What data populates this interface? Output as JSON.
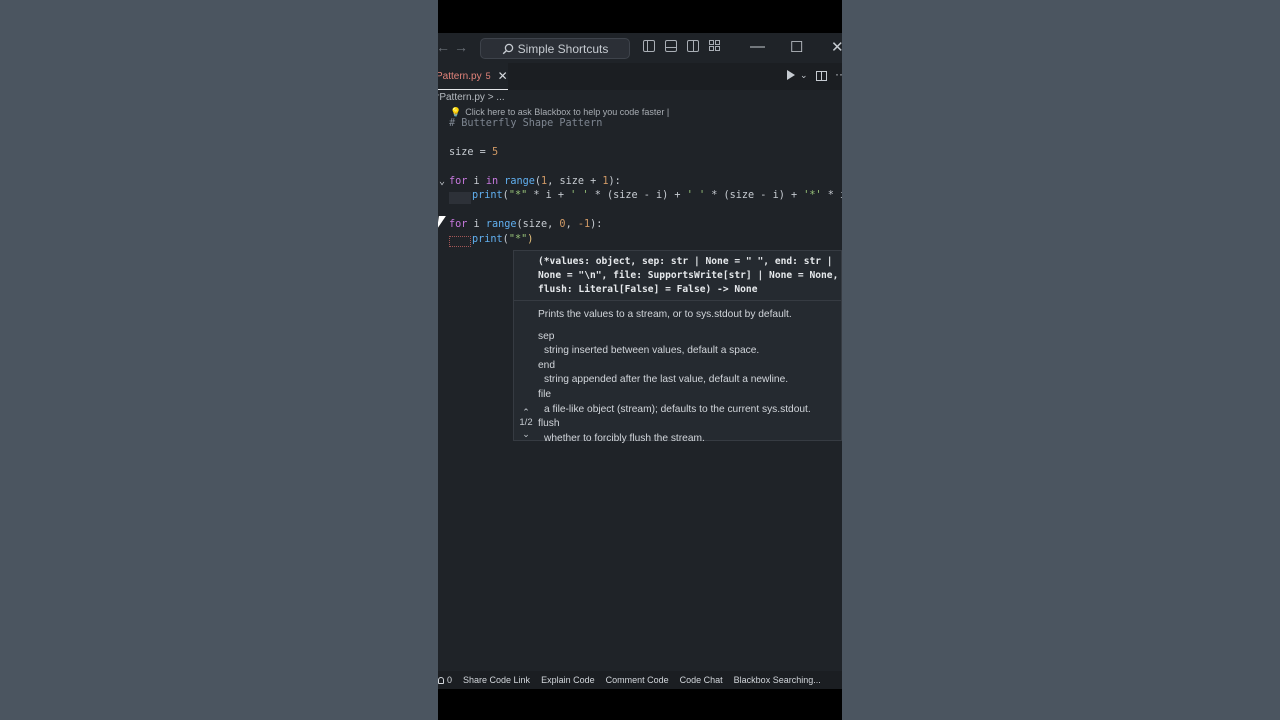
{
  "titlebar": {
    "nav_back": "←",
    "nav_forward": "→",
    "search_label": "Simple Shortcuts",
    "min": "—",
    "max": "☐",
    "close": "✕"
  },
  "tab": {
    "name": "Pattern.py",
    "problems": "5",
    "close": "✕"
  },
  "toolbar": {
    "run_dropdown": "⌄",
    "more": "···"
  },
  "breadcrumb": "rPattern.py > ...",
  "blackbox_hint": "Click here to ask Blackbox to help you code faster |",
  "code": {
    "l1": "# Butterfly Shape Pattern",
    "l2_a": "size",
    "l2_b": " = ",
    "l2_c": "5",
    "l3_for": "for",
    "l3_i": " i ",
    "l3_in": "in",
    "l3_range": " range",
    "l3_args_a": "(",
    "l3_args_1": "1",
    "l3_args_b": ", size + ",
    "l3_args_2": "1",
    "l3_args_c": "):",
    "l4_print": "print",
    "l4_open": "(",
    "l4_s1": "\"*\"",
    "l4_a": " * i + ",
    "l4_s2": "' '",
    "l4_b": " * (size - i) + ",
    "l4_s3": "' '",
    "l4_c": " * (size - i) + ",
    "l4_s4": "'*'",
    "l4_d": " * i)",
    "l5_for": "for",
    "l5_i": " i ",
    "l5_range": "range",
    "l5_args_a": "(size, ",
    "l5_n1": "0",
    "l5_args_b": ", ",
    "l5_n2": "-1",
    "l5_args_c": "):",
    "l6_print": "print",
    "l6_open": "(",
    "l6_s": "\"*\"",
    "l6_close": ")"
  },
  "popup": {
    "sig1": "(*values: object, sep: str | None = \" \", end: str |",
    "sig2": "None = \"\\n\", file: SupportsWrite[str] | None = None,",
    "sig3": "flush: Literal[False] = False) -> None",
    "summary": "Prints the values to a stream, or to sys.stdout by default.",
    "params": [
      {
        "name": "sep",
        "desc": "string inserted between values, default a space."
      },
      {
        "name": "end",
        "desc": "string appended after the last value, default a newline."
      },
      {
        "name": "file",
        "desc": "a file-like object (stream); defaults to the current sys.stdout."
      },
      {
        "name": "flush",
        "desc": "whether to forcibly flush the stream."
      }
    ],
    "page": "1/2",
    "up": "⌃",
    "down": "⌄"
  },
  "statusbar": {
    "count": "0",
    "items": [
      "Share Code Link",
      "Explain Code",
      "Comment Code",
      "Code Chat",
      "Blackbox Searching..."
    ]
  }
}
